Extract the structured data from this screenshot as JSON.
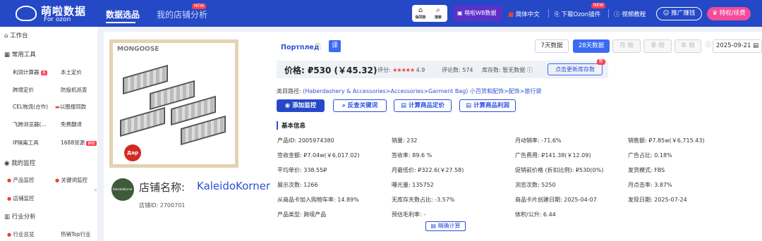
{
  "header": {
    "logo_cn": "萌啦数据",
    "logo_en": "For ozon",
    "nav_product": "数据选品",
    "nav_shop": "我的店铺分析",
    "new_badge": "NEW",
    "photo_search": "保同款",
    "search": "搜索",
    "wb_data": "萌啦WB数据",
    "lang": "简体中文",
    "download_plugin": "下载Ozon插件",
    "video_tutorial": "视频教程",
    "promo": "推广赚钱",
    "vip": "特权/续费"
  },
  "sidebar": {
    "workbench": "工作台",
    "common_tools": "常用工具",
    "tools": [
      {
        "label": "利润计算器",
        "tag": "热"
      },
      {
        "label": "本土定价",
        "tag": ""
      },
      {
        "label": "跨境定价",
        "tag": ""
      },
      {
        "label": "防投机巡查",
        "tag": ""
      },
      {
        "label": "CEL物流(合作)",
        "tag": ""
      },
      {
        "label": "以图搜同款",
        "tag": ""
      },
      {
        "label": "飞跨浏览器(...",
        "tag": ""
      },
      {
        "label": "免费翻译",
        "tag": ""
      },
      {
        "label": "IP隔离工具",
        "tag": ""
      },
      {
        "label": "1688货源",
        "tag": "推荐"
      }
    ],
    "my_monitor": "我的监控",
    "monitor_items": [
      "产品监控",
      "关键词监控",
      "店铺监控"
    ],
    "industry": "行业分析",
    "industry_items": [
      "行业总览",
      "热销Top行业"
    ]
  },
  "product": {
    "image_brand": "MONGOOSE",
    "sticker": "Дар",
    "title": "Портплед",
    "translate": "译",
    "shop_label": "店铺名称:",
    "shop_name": "KaleidoKorner",
    "avatar_text": "KaleidoKorner",
    "shop_id": "店铺ID: 2700701",
    "price": "价格: ₽530 (￥45.32)",
    "rating_label": "评分:",
    "rating_stars": "★★★★★",
    "rating_value": "4.9",
    "reviews": "评论数: 574",
    "stock": "库存数: 暂无数据 ⓘ",
    "update_stock": "点击更新库存数",
    "update_badge": "新",
    "category_prefix": "类目路径:",
    "category": "(Haberdashery & Accessories>Accessories>Garment Bag) 小百货和配饰>配饰>旅行袋"
  },
  "date_controls": {
    "d7": "7天数据",
    "d28": "28天数据",
    "month": "月 榜",
    "quarter": "季 榜",
    "year": "年 榜",
    "date": "2025-09-21"
  },
  "actions": {
    "monitor": "添加监控",
    "keywords": "反查关键词",
    "pricing": "计算商品定价",
    "profit": "计算商品利润"
  },
  "basic_info": {
    "title": "基本信息",
    "rows": [
      [
        "产品ID: 2005974380",
        "销量: 232",
        "月动销率: -71.6%",
        "销售额: ₽7.85w(￥6,715.43)"
      ],
      [
        "签收金额: ₽7.04w(￥6,017.02)",
        "签收率: 89.6 %",
        "广告费用: ₽141.38(￥12.09)",
        "广告占比: 0.18%"
      ],
      [
        "平均单价: 338.55₽",
        "月最低价: ₽322.6(￥27.58)",
        "促销前价格 (折扣比例): ₽530(0%)",
        "发货模式: FBS"
      ],
      [
        "展示次数: 1266",
        "曝光量: 135752",
        "浏览次数: 5250",
        "月点击率: 3.87%"
      ],
      [
        "从商品卡加入购物车率: 14.89%",
        "无库存天数占比: -3.57%",
        "商品卡片创建日期: 2025-04-07",
        "发现日期: 2025-07-24"
      ],
      [
        "产品类型: 跨境产品",
        "预估毛利率: -",
        "体积/公升: 6.44",
        ""
      ]
    ],
    "calc_button": "精确计算"
  }
}
